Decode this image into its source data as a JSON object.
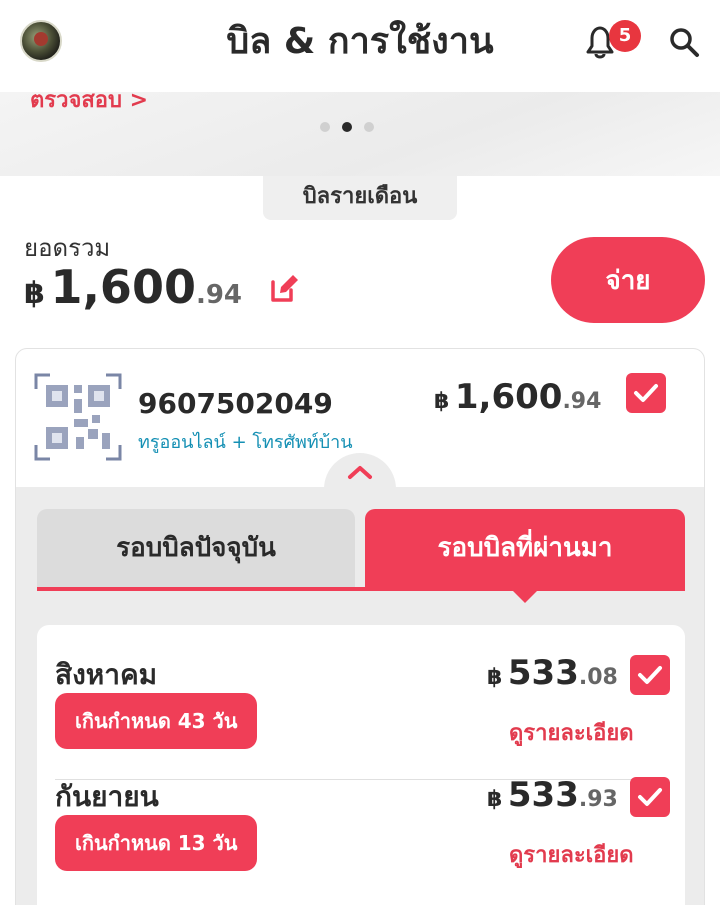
{
  "header": {
    "title": "บิล & การใช้งาน",
    "notification_count": "5",
    "icons": {
      "avatar": "avatar",
      "bell": "bell-icon",
      "search": "search-icon"
    }
  },
  "banner": {
    "link_text": "ตรวจสอบ >",
    "dots": 3,
    "active_dot": 2
  },
  "bill_type_tab": "บิลรายเดือน",
  "summary": {
    "total_label": "ยอดรวม",
    "currency": "฿",
    "amount_main": "1,600",
    "amount_decimal": ".94",
    "pay_label": "จ่าย"
  },
  "account": {
    "number": "9607502049",
    "service": "ทรูออนไลน์ + โทรศัพท์บ้าน",
    "currency": "฿",
    "amount_main": "1,600",
    "amount_decimal": ".94",
    "checked": true
  },
  "tabs": {
    "current": "รอบบิลปัจจุบัน",
    "past": "รอบบิลที่ผ่านมา",
    "active": "past"
  },
  "bills": [
    {
      "month": "สิงหาคม",
      "overdue": "เกินกำหนด 43 วัน",
      "currency": "฿",
      "amount_main": "533",
      "amount_decimal": ".08",
      "detail": "ดูรายละเอียด",
      "checked": true
    },
    {
      "month": "กันยายน",
      "overdue": "เกินกำหนด 13 วัน",
      "currency": "฿",
      "amount_main": "533",
      "amount_decimal": ".93",
      "detail": "ดูรายละเอียด",
      "checked": true
    }
  ],
  "colors": {
    "accent": "#f03e57",
    "link": "#1590b4",
    "badge": "#e8363f"
  }
}
